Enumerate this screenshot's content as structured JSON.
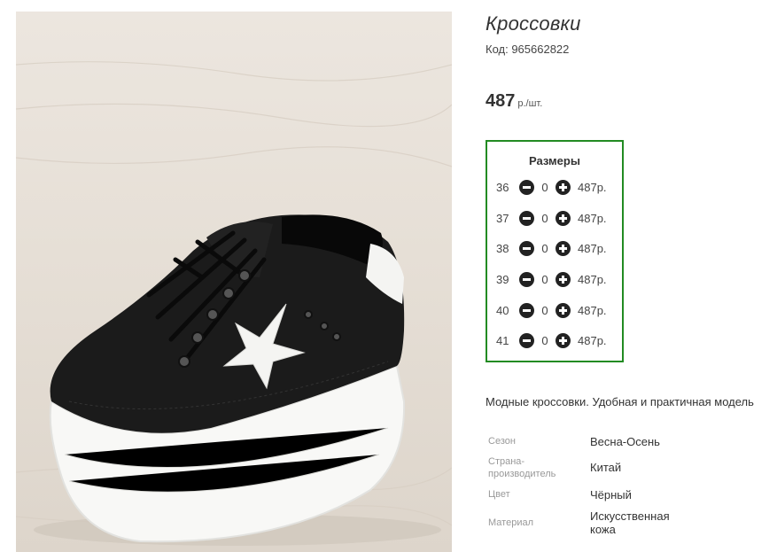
{
  "product": {
    "title": "Кроссовки",
    "code": "Код: 965662822",
    "price": "487",
    "price_unit": "р./шт."
  },
  "sizes": {
    "title": "Размеры",
    "rows": [
      {
        "size": "36",
        "qty": "0",
        "price": "487р."
      },
      {
        "size": "37",
        "qty": "0",
        "price": "487р."
      },
      {
        "size": "38",
        "qty": "0",
        "price": "487р."
      },
      {
        "size": "39",
        "qty": "0",
        "price": "487р."
      },
      {
        "size": "40",
        "qty": "0",
        "price": "487р."
      },
      {
        "size": "41",
        "qty": "0",
        "price": "487р."
      }
    ]
  },
  "description": "Модные кроссовки. Удобная и практичная модель",
  "attributes": [
    {
      "label": "Сезон",
      "value": "Весна-Осень"
    },
    {
      "label": "Страна-производитель",
      "value": "Китай"
    },
    {
      "label": "Цвет",
      "value": "Чёрный"
    },
    {
      "label": "Материал",
      "value": "Искусственная кожа"
    }
  ],
  "colors": {
    "border_accent": "#228b22",
    "button": "#222222"
  }
}
